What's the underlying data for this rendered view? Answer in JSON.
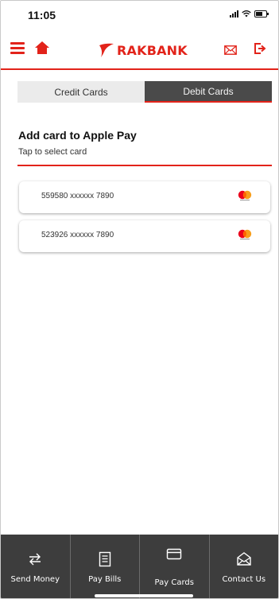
{
  "status_bar": {
    "time": "11:05"
  },
  "header": {
    "brand": "RAKBANK"
  },
  "tabs": [
    {
      "label": "Credit Cards",
      "active": false
    },
    {
      "label": "Debit Cards",
      "active": true
    }
  ],
  "section": {
    "title": "Add card to Apple Pay",
    "subtitle": "Tap to select card"
  },
  "cards": [
    {
      "number": "559580 xxxxxx 7890",
      "network_icon": "mastercard-icon"
    },
    {
      "number": "523926 xxxxxx 7890",
      "network_icon": "mastercard-icon"
    }
  ],
  "bottom_nav": [
    {
      "label": "Send Money",
      "icon": "transfer-icon"
    },
    {
      "label": "Pay Bills",
      "icon": "bill-icon"
    },
    {
      "label": "Pay Cards",
      "icon": "card-icon"
    },
    {
      "label": "Contact Us",
      "icon": "envelope-icon"
    }
  ],
  "colors": {
    "brand_red": "#e2231a",
    "nav_bg": "#3d3d3d",
    "tab_active": "#4a4a4a",
    "tab_inactive": "#ebebeb"
  }
}
